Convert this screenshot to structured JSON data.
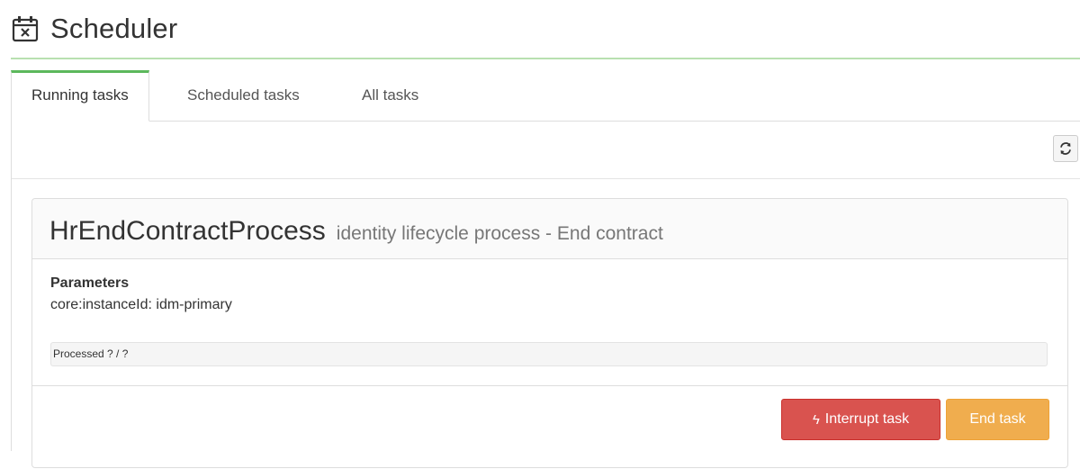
{
  "header": {
    "title": "Scheduler",
    "icon": "calendar-times-icon"
  },
  "tabs": [
    {
      "label": "Running tasks",
      "active": true
    },
    {
      "label": "Scheduled tasks",
      "active": false
    },
    {
      "label": "All tasks",
      "active": false
    }
  ],
  "toolbar": {
    "refresh_icon": "refresh-icon"
  },
  "task": {
    "name": "HrEndContractProcess",
    "description": "identity lifecycle process - End contract",
    "parameters_label": "Parameters",
    "parameter_line": "core:instanceId: idm-primary",
    "progress_text": "Processed ? / ?",
    "interrupt_label": "Interrupt task",
    "end_label": "End task"
  },
  "colors": {
    "accent_green": "#5cb85c",
    "danger": "#d9534f",
    "warning": "#f0ad4e"
  }
}
